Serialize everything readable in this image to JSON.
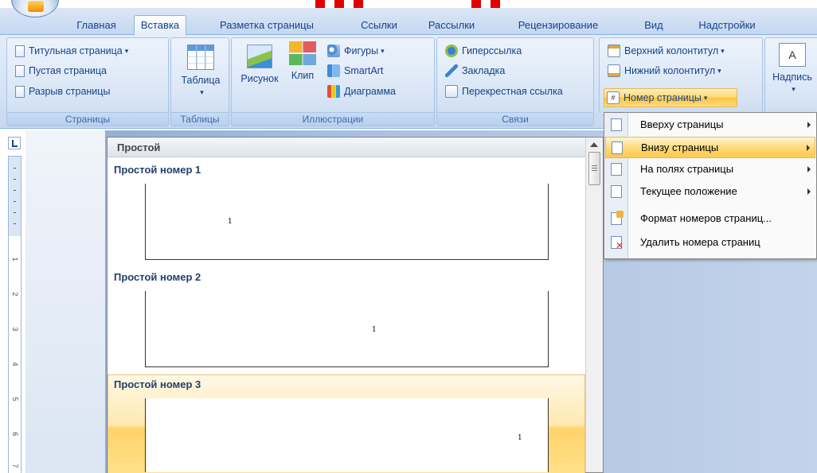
{
  "tabs": [
    "Главная",
    "Вставка",
    "Разметка страницы",
    "Ссылки",
    "Рассылки",
    "Рецензирование",
    "Вид",
    "Надстройки"
  ],
  "ribbon": {
    "pages": {
      "title_page": "Титульная страница",
      "blank_page": "Пустая страница",
      "page_break": "Разрыв страницы",
      "label": "Страницы"
    },
    "tables": {
      "table": "Таблица",
      "label": "Таблицы"
    },
    "illustrations": {
      "picture": "Рисунок",
      "clip": "Клип",
      "shapes": "Фигуры",
      "smartart": "SmartArt",
      "chart": "Диаграмма",
      "label": "Иллюстрации"
    },
    "links": {
      "hyperlink": "Гиперссылка",
      "bookmark": "Закладка",
      "cross_ref": "Перекрестная ссылка",
      "label": "Связи"
    },
    "header_footer": {
      "header": "Верхний колонтитул",
      "footer": "Нижний колонтитул",
      "page_number": "Номер страницы"
    },
    "text": {
      "textbox": "Надпись",
      "textbox_glyph": "A"
    }
  },
  "gallery": {
    "header": "Простой",
    "items": [
      {
        "title": "Простой номер 1",
        "num": "1"
      },
      {
        "title": "Простой номер 2",
        "num": "1"
      },
      {
        "title": "Простой номер 3",
        "num": "1"
      }
    ]
  },
  "menu": {
    "items": [
      "Вверху страницы",
      "Внизу страницы",
      "На полях страницы",
      "Текущее положение",
      "Формат номеров страниц...",
      "Удалить номера страниц"
    ]
  },
  "ruler_numbers": [
    "1",
    "2",
    "3",
    "4",
    "5",
    "6",
    "7"
  ]
}
